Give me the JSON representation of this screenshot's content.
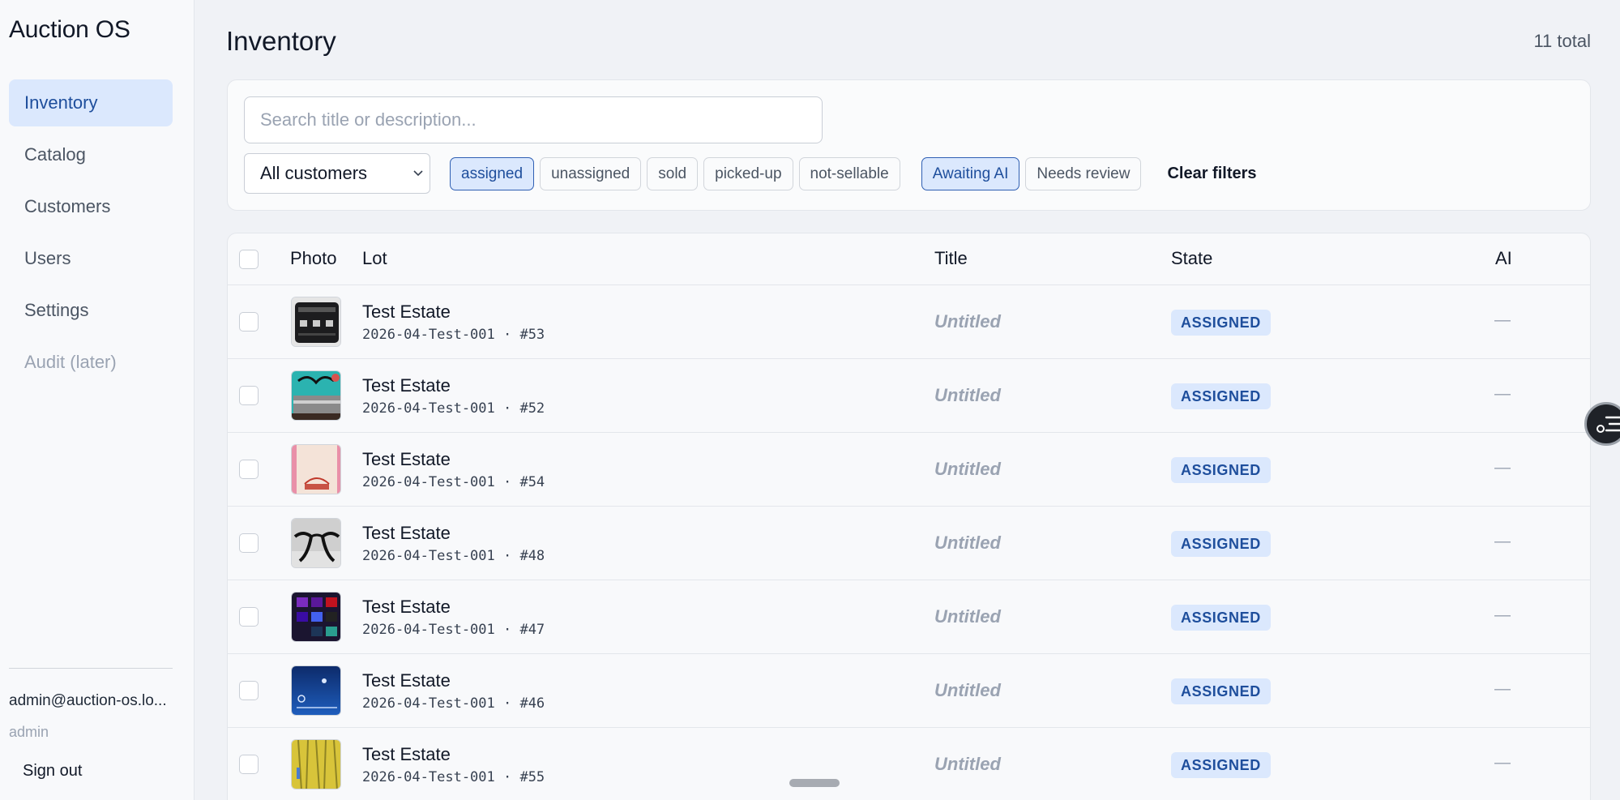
{
  "app": {
    "title": "Auction OS"
  },
  "sidebar": {
    "items": [
      {
        "label": "Inventory",
        "active": true
      },
      {
        "label": "Catalog"
      },
      {
        "label": "Customers"
      },
      {
        "label": "Users"
      },
      {
        "label": "Settings"
      },
      {
        "label": "Audit (later)",
        "muted": true
      }
    ],
    "user_email": "admin@auction-os.lo...",
    "user_role": "admin",
    "sign_out": "Sign out"
  },
  "header": {
    "title": "Inventory",
    "total": "11 total"
  },
  "filters": {
    "search_placeholder": "Search title or description...",
    "search_value": "",
    "customer_select": "All customers",
    "state_chips": [
      {
        "label": "assigned",
        "active": true
      },
      {
        "label": "unassigned"
      },
      {
        "label": "sold"
      },
      {
        "label": "picked-up"
      },
      {
        "label": "not-sellable"
      }
    ],
    "ai_chips": [
      {
        "label": "Awaiting AI",
        "active": true
      },
      {
        "label": "Needs review"
      }
    ],
    "clear_label": "Clear filters"
  },
  "table": {
    "columns": {
      "photo": "Photo",
      "lot": "Lot",
      "title": "Title",
      "state": "State",
      "ai": "AI"
    },
    "rows": [
      {
        "lot": "Test Estate",
        "code": "2026-04-Test-001 · #53",
        "title": "Untitled",
        "state": "ASSIGNED",
        "ai": "—",
        "photo": "black-case-icon"
      },
      {
        "lot": "Test Estate",
        "code": "2026-04-Test-001 · #52",
        "title": "Untitled",
        "state": "ASSIGNED",
        "ai": "—",
        "photo": "teal-tray-icon"
      },
      {
        "lot": "Test Estate",
        "code": "2026-04-Test-001 · #54",
        "title": "Untitled",
        "state": "ASSIGNED",
        "ai": "—",
        "photo": "tote-bag-icon"
      },
      {
        "lot": "Test Estate",
        "code": "2026-04-Test-001 · #48",
        "title": "Untitled",
        "state": "ASSIGNED",
        "ai": "—",
        "photo": "eyeglasses-icon"
      },
      {
        "lot": "Test Estate",
        "code": "2026-04-Test-001 · #47",
        "title": "Untitled",
        "state": "ASSIGNED",
        "ai": "—",
        "photo": "tv-screen-icon"
      },
      {
        "lot": "Test Estate",
        "code": "2026-04-Test-001 · #46",
        "title": "Untitled",
        "state": "ASSIGNED",
        "ai": "—",
        "photo": "blue-screen-icon"
      },
      {
        "lot": "Test Estate",
        "code": "2026-04-Test-001 · #55",
        "title": "Untitled",
        "state": "ASSIGNED",
        "ai": "—",
        "photo": "yellow-fabric-icon"
      }
    ]
  },
  "colors": {
    "accent": "#1e4e9c",
    "accent_bg": "#dbe8fd",
    "page_bg": "#f0f2f6"
  }
}
